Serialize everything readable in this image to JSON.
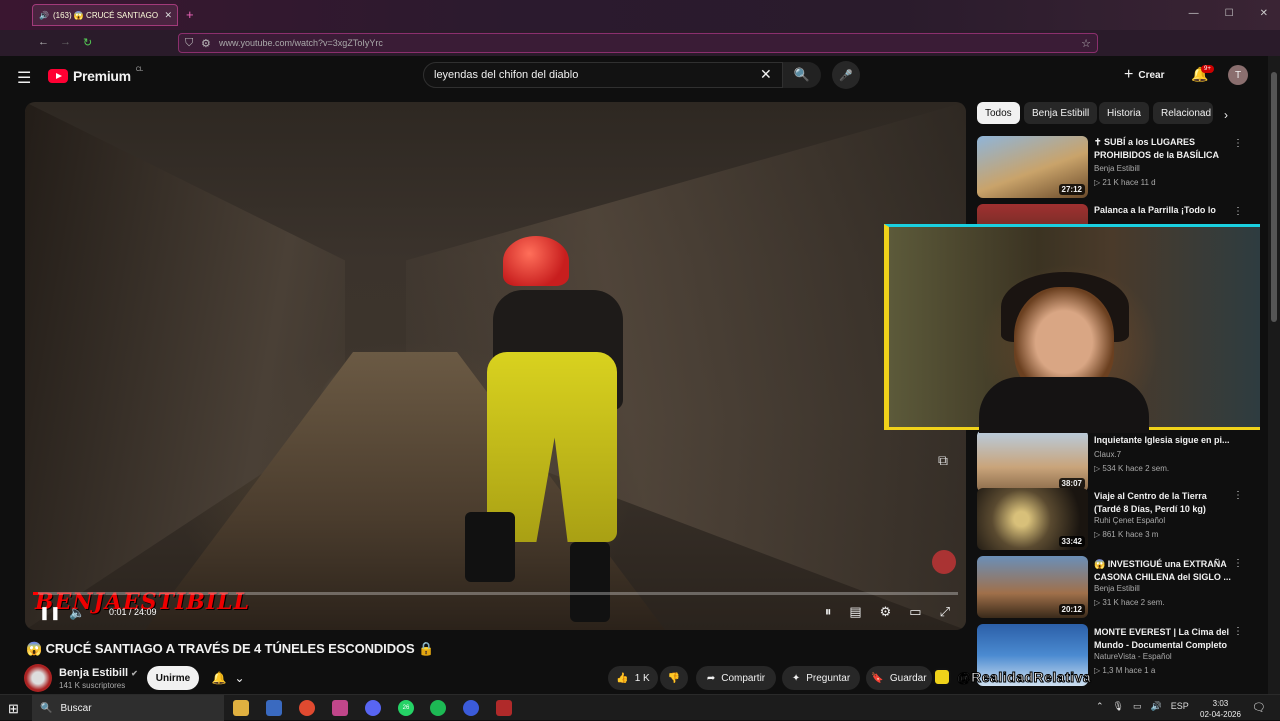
{
  "browser": {
    "tab_title": "(163) 😱 CRUCÉ SANTIAGO",
    "tab_close": "✕",
    "new_tab": "+",
    "url": "www.youtube.com/watch?v=3xgZToIyYrc",
    "window_controls": [
      "—",
      "☐",
      "✕"
    ]
  },
  "header": {
    "logo_text": "Premium",
    "logo_country": "CL",
    "search_value": "leyendas del chifon del diablo",
    "create_label": "Crear",
    "notifications_badge": "9+",
    "avatar_letter": "T"
  },
  "player": {
    "watermark": "BENJAESTIBILL",
    "time": "0:01 / 24:09",
    "progress_fraction": 0.0007
  },
  "video": {
    "title": "😱 CRUCÉ SANTIAGO A TRAVÉS DE 4 TÚNELES ESCONDIDOS 🔒",
    "channel": "Benja Estibill",
    "subscribers": "141 K suscriptores",
    "join_label": "Unirme",
    "likes": "1 K",
    "share_label": "Compartir",
    "ask_label": "Preguntar",
    "save_label": "Guardar"
  },
  "chips": [
    "Todos",
    "Benja Estibill",
    "Historia",
    "Relacionad"
  ],
  "recommendations": [
    {
      "title": "✝ SUBÍ a los LUGARES PROHIBIDOS de la BASÍLICA d...",
      "channel": "Benja Estibill",
      "meta": "▷ 21 K  hace 11 d",
      "duration": "27:12",
      "thumb_color": "#c9a36a"
    },
    {
      "title": "Palanca a la Parrilla ¡Todo lo",
      "channel": "",
      "meta": "",
      "duration": "",
      "thumb_color": "#a03030"
    },
    {
      "title": "Inquietante Iglesia sigue en pi...",
      "channel": "Claux.7",
      "meta": "▷ 534 K  hace 2 sem.",
      "duration": "38:07",
      "thumb_color": "#8fa7bf"
    },
    {
      "title": "Viaje al Centro de la Tierra (Tardé 8 Días, Perdí 10 kg)",
      "channel": "Ruhi Çenet Español",
      "meta": "▷ 861 K  hace 3 m",
      "duration": "33:42",
      "thumb_color": "#5a4a30"
    },
    {
      "title": "😱 INVESTIGUÉ una EXTRAÑA CASONA CHILENA del SIGLO ...",
      "channel": "Benja Estibill",
      "meta": "▷ 31 K  hace 2 sem.",
      "duration": "20:12",
      "thumb_color": "#6a8fb8"
    },
    {
      "title": "MONTE EVEREST | La Cima del Mundo - Documental Completo",
      "channel": "NatureVista - Español",
      "meta": "▷ 1,3 M  hace 1 a",
      "duration": "",
      "thumb_color": "#2b5fa8"
    }
  ],
  "overlay": {
    "handle": "@RealidadRelativa"
  },
  "taskbar": {
    "search_placeholder": "Buscar",
    "language": "ESP",
    "time": "3:03",
    "date": "02-04-2026",
    "whatsapp_badge": "26"
  }
}
